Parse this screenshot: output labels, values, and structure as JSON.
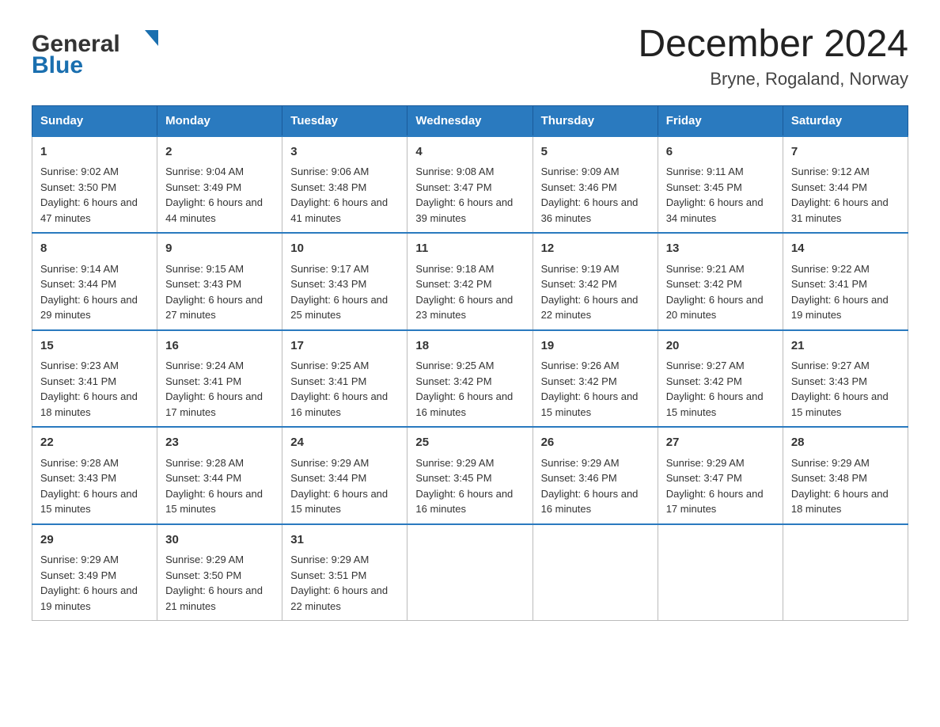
{
  "header": {
    "logo_text_general": "General",
    "logo_text_blue": "Blue",
    "title": "December 2024",
    "subtitle": "Bryne, Rogaland, Norway"
  },
  "days_of_week": [
    "Sunday",
    "Monday",
    "Tuesday",
    "Wednesday",
    "Thursday",
    "Friday",
    "Saturday"
  ],
  "weeks": [
    [
      {
        "day": "1",
        "sunrise": "9:02 AM",
        "sunset": "3:50 PM",
        "daylight": "6 hours and 47 minutes."
      },
      {
        "day": "2",
        "sunrise": "9:04 AM",
        "sunset": "3:49 PM",
        "daylight": "6 hours and 44 minutes."
      },
      {
        "day": "3",
        "sunrise": "9:06 AM",
        "sunset": "3:48 PM",
        "daylight": "6 hours and 41 minutes."
      },
      {
        "day": "4",
        "sunrise": "9:08 AM",
        "sunset": "3:47 PM",
        "daylight": "6 hours and 39 minutes."
      },
      {
        "day": "5",
        "sunrise": "9:09 AM",
        "sunset": "3:46 PM",
        "daylight": "6 hours and 36 minutes."
      },
      {
        "day": "6",
        "sunrise": "9:11 AM",
        "sunset": "3:45 PM",
        "daylight": "6 hours and 34 minutes."
      },
      {
        "day": "7",
        "sunrise": "9:12 AM",
        "sunset": "3:44 PM",
        "daylight": "6 hours and 31 minutes."
      }
    ],
    [
      {
        "day": "8",
        "sunrise": "9:14 AM",
        "sunset": "3:44 PM",
        "daylight": "6 hours and 29 minutes."
      },
      {
        "day": "9",
        "sunrise": "9:15 AM",
        "sunset": "3:43 PM",
        "daylight": "6 hours and 27 minutes."
      },
      {
        "day": "10",
        "sunrise": "9:17 AM",
        "sunset": "3:43 PM",
        "daylight": "6 hours and 25 minutes."
      },
      {
        "day": "11",
        "sunrise": "9:18 AM",
        "sunset": "3:42 PM",
        "daylight": "6 hours and 23 minutes."
      },
      {
        "day": "12",
        "sunrise": "9:19 AM",
        "sunset": "3:42 PM",
        "daylight": "6 hours and 22 minutes."
      },
      {
        "day": "13",
        "sunrise": "9:21 AM",
        "sunset": "3:42 PM",
        "daylight": "6 hours and 20 minutes."
      },
      {
        "day": "14",
        "sunrise": "9:22 AM",
        "sunset": "3:41 PM",
        "daylight": "6 hours and 19 minutes."
      }
    ],
    [
      {
        "day": "15",
        "sunrise": "9:23 AM",
        "sunset": "3:41 PM",
        "daylight": "6 hours and 18 minutes."
      },
      {
        "day": "16",
        "sunrise": "9:24 AM",
        "sunset": "3:41 PM",
        "daylight": "6 hours and 17 minutes."
      },
      {
        "day": "17",
        "sunrise": "9:25 AM",
        "sunset": "3:41 PM",
        "daylight": "6 hours and 16 minutes."
      },
      {
        "day": "18",
        "sunrise": "9:25 AM",
        "sunset": "3:42 PM",
        "daylight": "6 hours and 16 minutes."
      },
      {
        "day": "19",
        "sunrise": "9:26 AM",
        "sunset": "3:42 PM",
        "daylight": "6 hours and 15 minutes."
      },
      {
        "day": "20",
        "sunrise": "9:27 AM",
        "sunset": "3:42 PM",
        "daylight": "6 hours and 15 minutes."
      },
      {
        "day": "21",
        "sunrise": "9:27 AM",
        "sunset": "3:43 PM",
        "daylight": "6 hours and 15 minutes."
      }
    ],
    [
      {
        "day": "22",
        "sunrise": "9:28 AM",
        "sunset": "3:43 PM",
        "daylight": "6 hours and 15 minutes."
      },
      {
        "day": "23",
        "sunrise": "9:28 AM",
        "sunset": "3:44 PM",
        "daylight": "6 hours and 15 minutes."
      },
      {
        "day": "24",
        "sunrise": "9:29 AM",
        "sunset": "3:44 PM",
        "daylight": "6 hours and 15 minutes."
      },
      {
        "day": "25",
        "sunrise": "9:29 AM",
        "sunset": "3:45 PM",
        "daylight": "6 hours and 16 minutes."
      },
      {
        "day": "26",
        "sunrise": "9:29 AM",
        "sunset": "3:46 PM",
        "daylight": "6 hours and 16 minutes."
      },
      {
        "day": "27",
        "sunrise": "9:29 AM",
        "sunset": "3:47 PM",
        "daylight": "6 hours and 17 minutes."
      },
      {
        "day": "28",
        "sunrise": "9:29 AM",
        "sunset": "3:48 PM",
        "daylight": "6 hours and 18 minutes."
      }
    ],
    [
      {
        "day": "29",
        "sunrise": "9:29 AM",
        "sunset": "3:49 PM",
        "daylight": "6 hours and 19 minutes."
      },
      {
        "day": "30",
        "sunrise": "9:29 AM",
        "sunset": "3:50 PM",
        "daylight": "6 hours and 21 minutes."
      },
      {
        "day": "31",
        "sunrise": "9:29 AM",
        "sunset": "3:51 PM",
        "daylight": "6 hours and 22 minutes."
      },
      null,
      null,
      null,
      null
    ]
  ]
}
